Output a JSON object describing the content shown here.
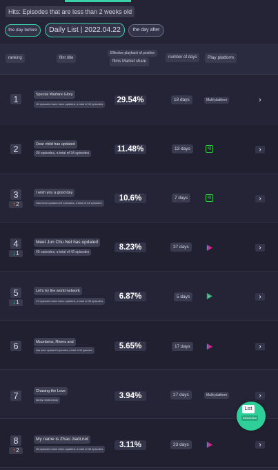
{
  "hint": "Hits: Episodes that are less than 2 weeks old",
  "nav": {
    "prev": "the day before",
    "title": "Daily List | 2022.04.22",
    "next": "the day after"
  },
  "header": {
    "ranking": "ranking",
    "film_title": "film title",
    "share_line1": "Effective playback of positive",
    "share_line2": "films Market share",
    "days": "number of days",
    "platform": "Play platform"
  },
  "rows": [
    {
      "rank": "1",
      "change": "",
      "dir": "",
      "title": "Special Warfare Glory",
      "subtitle": "40 episodes have been updated, a total of 40 episodes",
      "share": "29.54%",
      "days": "18 days",
      "platform": "Multi-platform",
      "platform_icon": "text"
    },
    {
      "rank": "2",
      "change": "",
      "dir": "",
      "title": "Dear child has updated",
      "subtitle": "30 episodes, a total of 34 episodes",
      "share": "11.48%",
      "days": "13 days",
      "platform": "",
      "platform_icon": "iqiyi-icon"
    },
    {
      "rank": "3",
      "change": "2",
      "dir": "up",
      "title": "I wish you a good day",
      "subtitle": "Has been updated 24 episodes, a total of 34 episodes",
      "share": "10.6%",
      "days": "7 days",
      "platform": "",
      "platform_icon": "iqiyi-icon"
    },
    {
      "rank": "4",
      "change": "1",
      "dir": "down",
      "title": "Meet Jun Chu Net has updated",
      "subtitle": "40 episodes, a total of 42 episodes",
      "share": "8.23%",
      "days": "37 days",
      "platform": "",
      "platform_icon": "youku-icon"
    },
    {
      "rank": "5",
      "change": "1",
      "dir": "down",
      "title": "Let's try the world network",
      "subtitle": "12 episodes have been updated, a total of 36 episodes",
      "share": "6.87%",
      "days": "5 days",
      "platform": "",
      "platform_icon": "tencent-video-icon"
    },
    {
      "rank": "6",
      "change": "",
      "dir": "",
      "title": "Mountains, Rivers and",
      "subtitle": "Has been updated 8 episodes, a total of 40 episodes",
      "share": "5.65%",
      "days": "17 days",
      "platform": "",
      "platform_icon": "youku-icon"
    },
    {
      "rank": "7",
      "change": "",
      "dir": "",
      "title": "Chasing the Love",
      "subtitle": "family relationship",
      "share": "3.94%",
      "days": "27 days",
      "platform": "Multi-platform",
      "platform_icon": "text"
    },
    {
      "rank": "8",
      "change": "2",
      "dir": "up",
      "title": "My name is Zhao Jiadi.net",
      "subtitle": "36 episodes have been updated, a total of 36 episodes",
      "share": "3.11%",
      "days": "23 days",
      "platform": "",
      "platform_icon": "youku-icon"
    }
  ],
  "fab": {
    "label": "List",
    "sub": "Description"
  },
  "colors": {
    "accent": "#3ad1a8",
    "background": "#242436",
    "up": "#ff7a45",
    "down": "#3ad1a8",
    "iqiyi": "#2fcf3a",
    "youku": "#e0237a"
  }
}
